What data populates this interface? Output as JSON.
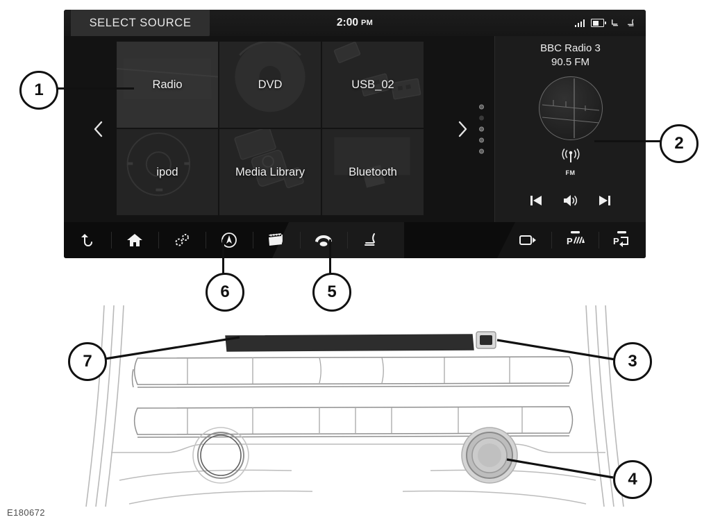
{
  "figure": {
    "code": "E180672"
  },
  "screen": {
    "header": {
      "tab_label": "SELECT SOURCE"
    },
    "clock": {
      "time": "2:00",
      "ampm": "PM"
    },
    "status_icons": [
      {
        "name": "signal-strength-icon",
        "label": "signal"
      },
      {
        "name": "battery-icon",
        "label": "battery"
      },
      {
        "name": "seat-heater-left-icon",
        "label": "seat left"
      },
      {
        "name": "seat-heater-right-icon",
        "label": "seat right"
      }
    ],
    "sources": [
      {
        "label": "Radio",
        "selected": true,
        "art": "radio"
      },
      {
        "label": "DVD",
        "selected": false,
        "art": "disc"
      },
      {
        "label": "USB_02",
        "selected": false,
        "art": "usb"
      },
      {
        "label": "ipod",
        "selected": false,
        "art": "ipod"
      },
      {
        "label": "Media Library",
        "selected": false,
        "art": "library"
      },
      {
        "label": "Bluetooth",
        "selected": false,
        "art": "bluetooth"
      }
    ],
    "pager": {
      "prev_icon": "chevron-left-icon",
      "next_icon": "chevron-right-icon",
      "dots": [
        true,
        false,
        true,
        true,
        true
      ]
    },
    "now_playing": {
      "station": "BBC Radio 3",
      "frequency": "90.5 FM",
      "band": "FM",
      "band_icon": "radio-waves-icon",
      "controls": [
        {
          "name": "previous-track-button",
          "icon": "skip-back-icon"
        },
        {
          "name": "volume-button",
          "icon": "speaker-icon"
        },
        {
          "name": "next-track-button",
          "icon": "skip-forward-icon"
        }
      ]
    },
    "toolbar_left": [
      {
        "name": "back-button",
        "icon": "back-arrow-icon"
      },
      {
        "name": "home-button",
        "icon": "home-icon"
      },
      {
        "name": "settings-button",
        "icon": "gears-icon"
      },
      {
        "name": "navigation-button",
        "icon": "compass-icon"
      },
      {
        "name": "media-button",
        "icon": "clapperboard-icon"
      },
      {
        "name": "phone-button",
        "icon": "telephone-icon"
      },
      {
        "name": "climate-seat-button",
        "icon": "seat-icon"
      }
    ],
    "toolbar_right": [
      {
        "name": "camera-button",
        "icon": "camera-icon"
      },
      {
        "name": "park-distance-button",
        "icon": "park-sensor-icon"
      },
      {
        "name": "park-assist-button",
        "icon": "park-assist-icon"
      }
    ]
  },
  "callouts": [
    {
      "number": "1",
      "target": "radio-source-tile"
    },
    {
      "number": "2",
      "target": "now-playing-panel"
    },
    {
      "number": "3",
      "target": "eject-button"
    },
    {
      "number": "4",
      "target": "rotary-knob"
    },
    {
      "number": "5",
      "target": "media-button"
    },
    {
      "number": "6",
      "target": "settings-button"
    },
    {
      "number": "7",
      "target": "disc-slot"
    }
  ]
}
